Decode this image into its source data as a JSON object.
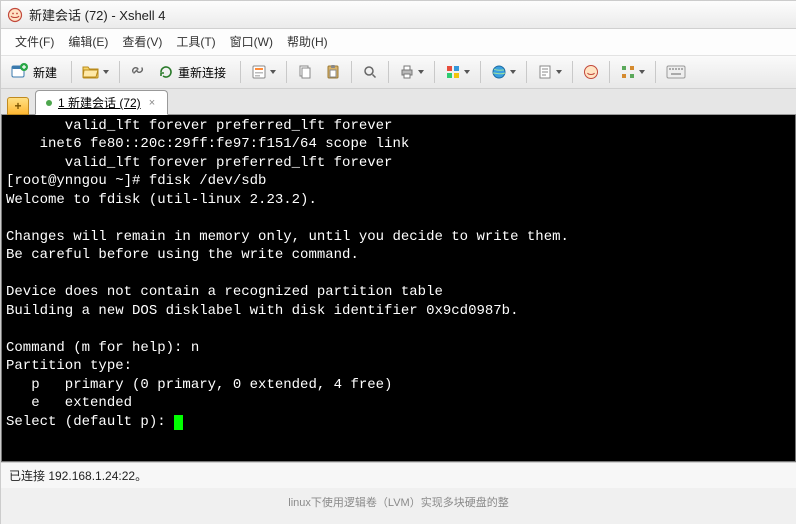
{
  "titlebar": {
    "text": "新建会话 (72) - Xshell 4"
  },
  "menubar": {
    "file": "文件(F)",
    "edit": "编辑(E)",
    "view": "查看(V)",
    "tools": "工具(T)",
    "window": "窗口(W)",
    "help": "帮助(H)"
  },
  "toolbar": {
    "new_label": "新建",
    "reconnect_label": "重新连接"
  },
  "addtab_glyph": "+",
  "tab": {
    "label": "1 新建会话 (72)",
    "close_glyph": "×"
  },
  "terminal": {
    "lines": [
      "       valid_lft forever preferred_lft forever",
      "    inet6 fe80::20c:29ff:fe97:f151/64 scope link",
      "       valid_lft forever preferred_lft forever",
      "[root@ynngou ~]# fdisk /dev/sdb",
      "Welcome to fdisk (util-linux 2.23.2).",
      "",
      "Changes will remain in memory only, until you decide to write them.",
      "Be careful before using the write command.",
      "",
      "Device does not contain a recognized partition table",
      "Building a new DOS disklabel with disk identifier 0x9cd0987b.",
      "",
      "Command (m for help): n",
      "Partition type:",
      "   p   primary (0 primary, 0 extended, 4 free)",
      "   e   extended",
      "Select (default p): "
    ]
  },
  "statusbar": {
    "text": "已连接 192.168.1.24:22。"
  },
  "footer": {
    "text": "linux下使用逻辑卷（LVM）实现多块硬盘的整"
  }
}
